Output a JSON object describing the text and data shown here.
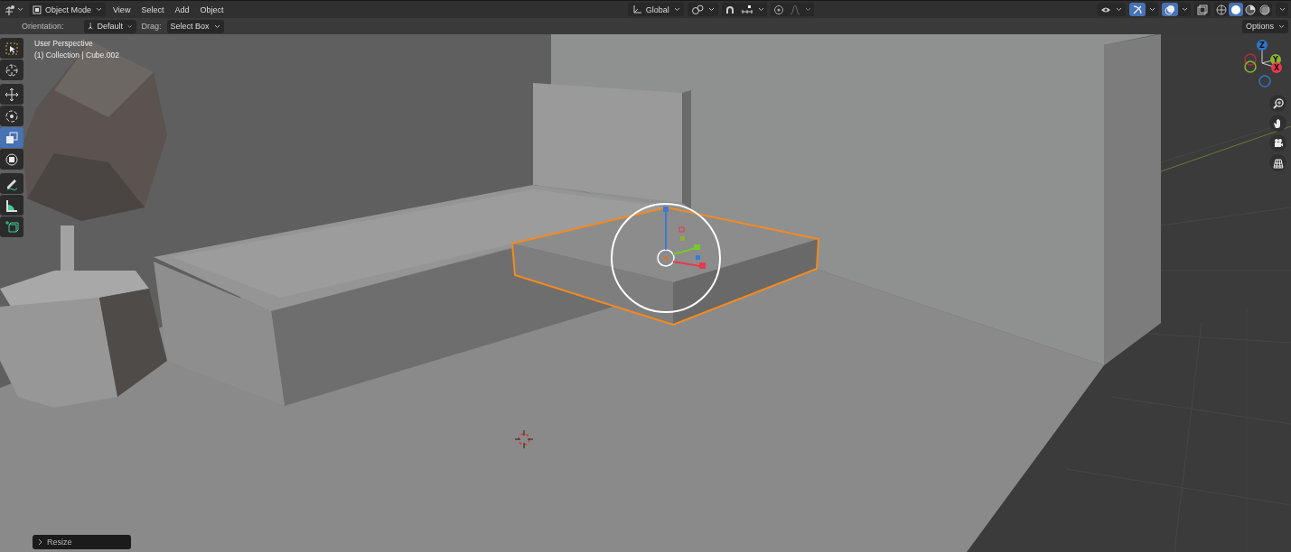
{
  "header": {
    "mode": "Object Mode",
    "menus": [
      "View",
      "Select",
      "Add",
      "Object"
    ],
    "orientation": "Global",
    "snap_on": false,
    "proportional_on": false,
    "gizmos_on": true,
    "overlays_on": true,
    "xray_on": false,
    "shading": [
      {
        "kind": "wireframe",
        "selected": false
      },
      {
        "kind": "solid",
        "selected": true
      },
      {
        "kind": "material",
        "selected": false
      },
      {
        "kind": "rendered",
        "selected": false
      }
    ]
  },
  "tool_settings": {
    "orientation_label": "Orientation:",
    "orientation": "Default",
    "drag_label": "Drag:",
    "drag": "Select Box",
    "options": "Options"
  },
  "viewport": {
    "view_name": "User Perspective",
    "object_info": "(1) Collection | Cube.002"
  },
  "toolbar": [
    {
      "kind": "select_box",
      "selected": false
    },
    {
      "kind": "cursor",
      "selected": false
    },
    {
      "kind": "move",
      "selected": false
    },
    {
      "kind": "rotate",
      "selected": false
    },
    {
      "kind": "scale",
      "selected": true
    },
    {
      "kind": "transform",
      "selected": false
    },
    {
      "kind": "annotate",
      "selected": false
    },
    {
      "kind": "measure",
      "selected": false
    },
    {
      "kind": "add_cube",
      "selected": false
    }
  ],
  "navigation_gizmo": [
    {
      "label": "Z",
      "color": "#2f74c8"
    },
    {
      "label": "Y",
      "color": "#8ab52b"
    },
    {
      "label": "X",
      "color": "#e8394f"
    }
  ],
  "last_operator": {
    "title": "Resize",
    "expanded": false
  }
}
